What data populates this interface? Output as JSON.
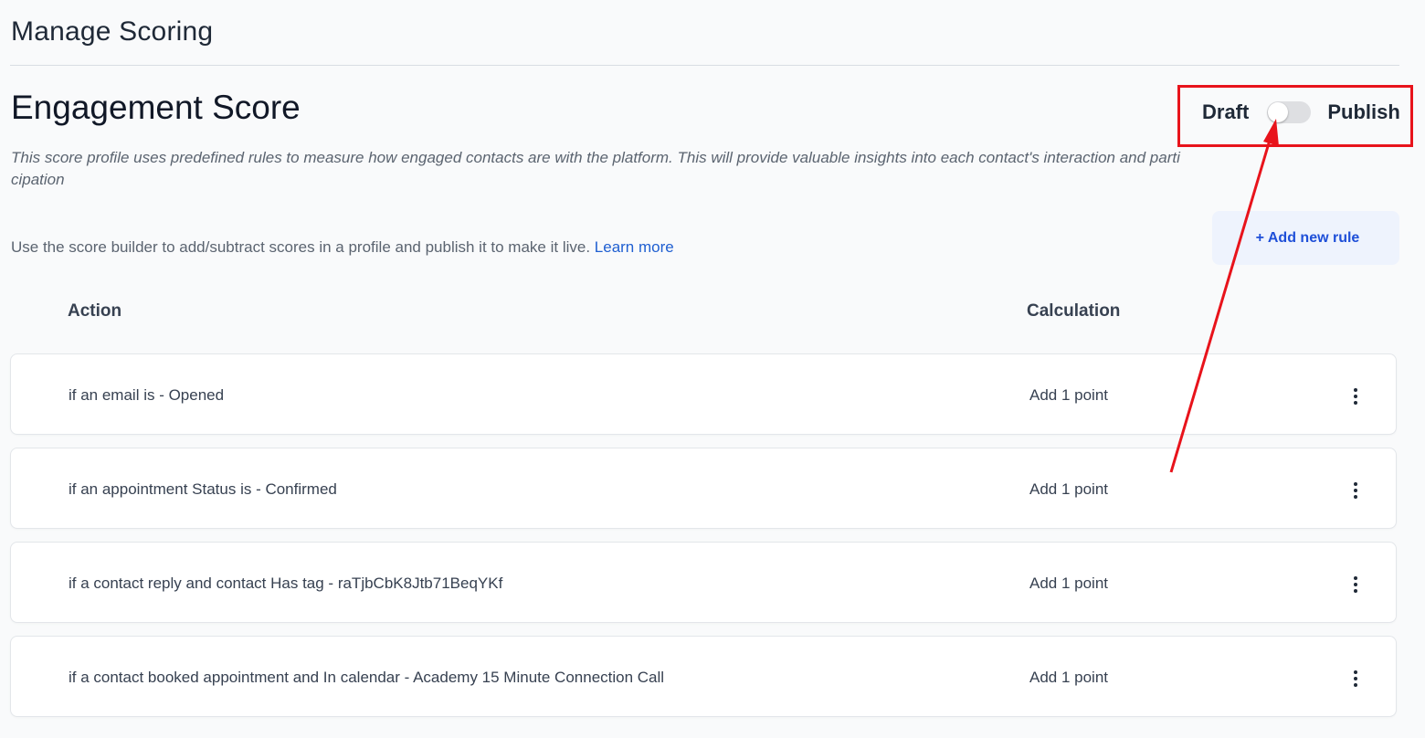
{
  "page": {
    "title": "Manage Scoring"
  },
  "profile": {
    "title": "Engagement Score",
    "description": "This score profile uses predefined rules to measure how engaged contacts are with the platform. This will provide valuable insights into each contact's interaction and participation",
    "help_text": "Use the score builder to add/subtract scores in a profile and publish it to make it live.",
    "learn_more": "Learn more"
  },
  "status_toggle": {
    "left_label": "Draft",
    "right_label": "Publish",
    "published": false
  },
  "add_rule_button": "+ Add new rule",
  "table": {
    "columns": [
      "Action",
      "Calculation"
    ],
    "rows": [
      {
        "action": "if an email is - Opened",
        "calculation": "Add 1 point"
      },
      {
        "action": "if an appointment Status is - Confirmed",
        "calculation": "Add 1 point"
      },
      {
        "action": "if a contact reply and contact Has tag - raTjbCbK8Jtb71BeqYKf",
        "calculation": "Add 1 point"
      },
      {
        "action": "if a contact booked appointment and In calendar - Academy 15 Minute Connection Call",
        "calculation": "Add 1 point"
      }
    ]
  },
  "colors": {
    "annotation": "#e8131b",
    "link": "#1f5fd1",
    "button_text": "#1e4fd8",
    "button_bg": "#eef3fd"
  },
  "icons": {
    "row_menu": "more-vertical-icon"
  }
}
